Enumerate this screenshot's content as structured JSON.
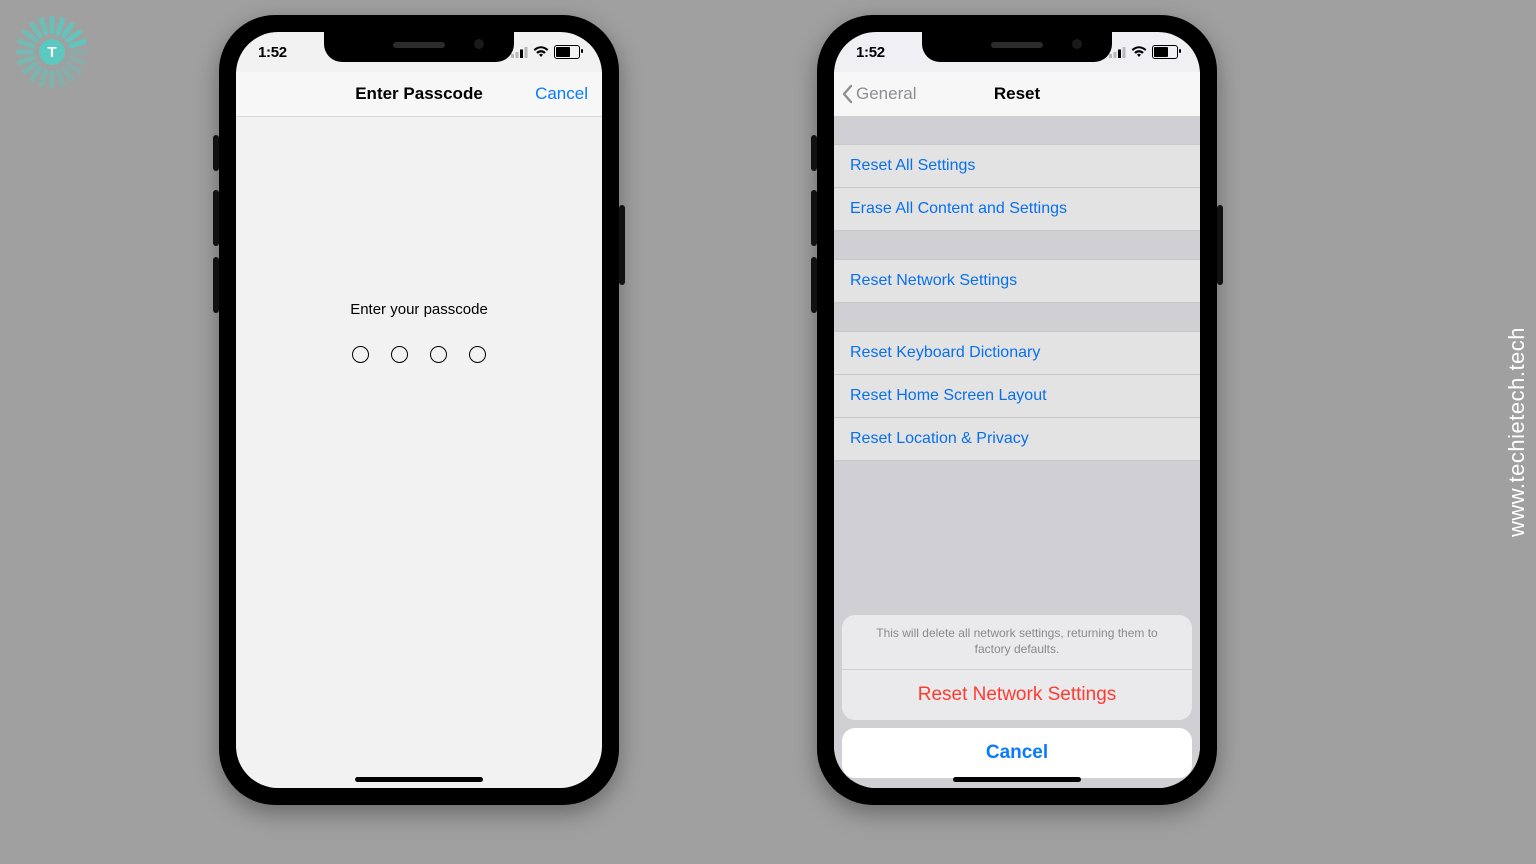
{
  "watermark": "www.techietech.tech",
  "status": {
    "time": "1:52"
  },
  "phone1": {
    "nav": {
      "title": "Enter Passcode",
      "cancel": "Cancel"
    },
    "prompt": "Enter your passcode",
    "digits": 4
  },
  "phone2": {
    "nav": {
      "back": "General",
      "title": "Reset"
    },
    "groups": [
      [
        "Reset All Settings",
        "Erase All Content and Settings"
      ],
      [
        "Reset Network Settings"
      ],
      [
        "Reset Keyboard Dictionary",
        "Reset Home Screen Layout",
        "Reset Location & Privacy"
      ]
    ],
    "sheet": {
      "message": "This will delete all network settings, returning them to factory defaults.",
      "destructive": "Reset Network Settings",
      "cancel": "Cancel"
    }
  }
}
